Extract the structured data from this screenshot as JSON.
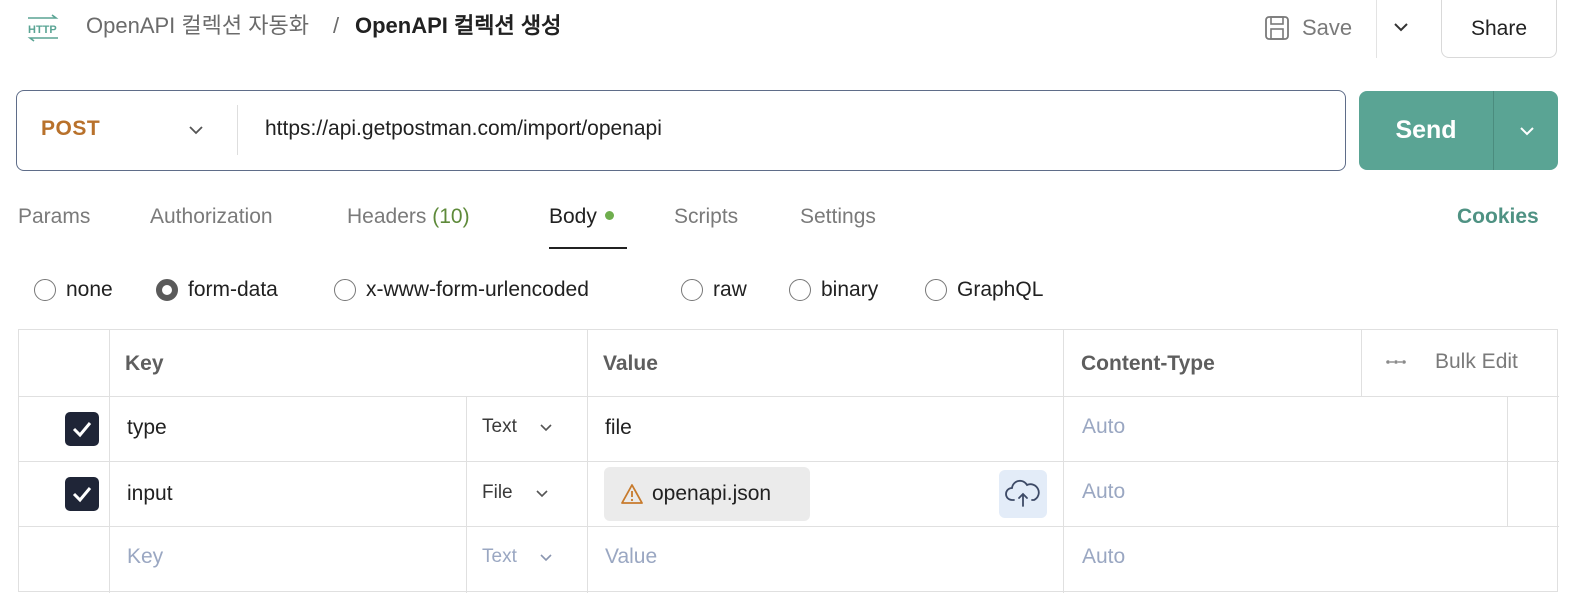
{
  "header": {
    "breadcrumb_parent": "OpenAPI 컬렉션 자동화",
    "breadcrumb_separator": "/",
    "title": "OpenAPI 컬렉션 생성",
    "save_label": "Save",
    "share_label": "Share"
  },
  "request": {
    "method": "POST",
    "url": "https://api.getpostman.com/import/openapi",
    "send_label": "Send"
  },
  "tabs": [
    {
      "label": "Params"
    },
    {
      "label": "Authorization"
    },
    {
      "label": "Headers",
      "count": "(10)"
    },
    {
      "label": "Body",
      "active": true
    },
    {
      "label": "Scripts"
    },
    {
      "label": "Settings"
    }
  ],
  "cookies_label": "Cookies",
  "body_types": [
    {
      "label": "none",
      "selected": false
    },
    {
      "label": "form-data",
      "selected": true
    },
    {
      "label": "x-www-form-urlencoded",
      "selected": false
    },
    {
      "label": "raw",
      "selected": false
    },
    {
      "label": "binary",
      "selected": false
    },
    {
      "label": "GraphQL",
      "selected": false
    }
  ],
  "table": {
    "headers": {
      "key": "Key",
      "value": "Value",
      "content_type": "Content-Type",
      "bulk_edit": "Bulk Edit"
    },
    "rows": [
      {
        "checked": true,
        "key": "type",
        "type": "Text",
        "value": "file",
        "content_type": "Auto"
      },
      {
        "checked": true,
        "key": "input",
        "type": "File",
        "value": "openapi.json",
        "content_type": "Auto"
      }
    ],
    "empty_row": {
      "key_placeholder": "Key",
      "type": "Text",
      "value_placeholder": "Value",
      "content_type": "Auto"
    }
  },
  "colors": {
    "method": "#b8712b",
    "send": "#5aa494",
    "accent": "#4f9283",
    "dot": "#6fae4e",
    "warning": "#c77a2c"
  }
}
